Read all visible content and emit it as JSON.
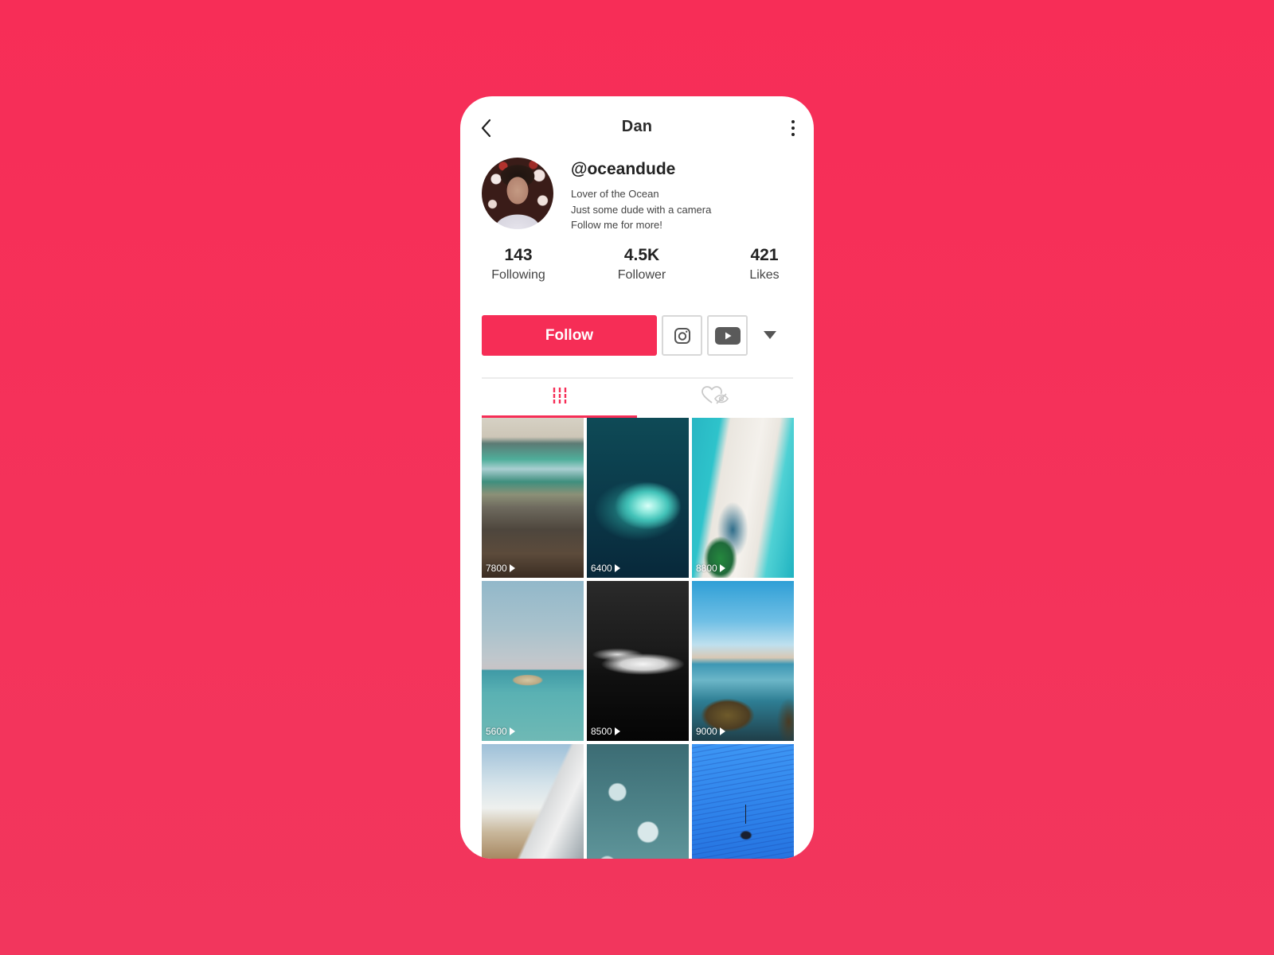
{
  "header": {
    "title": "Dan",
    "back_icon": "chevron-left-icon",
    "more_icon": "vertical-dots-icon"
  },
  "profile": {
    "handle": "@oceandude",
    "bio": [
      "Lover of the Ocean",
      "Just some dude with a camera",
      "Follow me for more!"
    ],
    "avatar": "profile-photo"
  },
  "stats": [
    {
      "value": "143",
      "label": "Following"
    },
    {
      "value": "4.5K",
      "label": "Follower"
    },
    {
      "value": "421",
      "label": "Likes"
    }
  ],
  "actions": {
    "follow_label": "Follow",
    "instagram_icon": "instagram-icon",
    "youtube_icon": "youtube-icon",
    "dropdown_icon": "caret-down-icon"
  },
  "tabs": [
    {
      "name": "videos",
      "icon": "grid-bars-icon",
      "active": true
    },
    {
      "name": "liked",
      "icon": "hidden-heart-icon",
      "active": false
    }
  ],
  "colors": {
    "brand": "#f62d56",
    "background": "#f72d57",
    "text": "#222222",
    "muted": "#444444"
  },
  "videos": [
    {
      "views": "7800",
      "subject": "wave on pebble beach"
    },
    {
      "views": "6400",
      "subject": "aerial reef in deep water"
    },
    {
      "views": "8800",
      "subject": "aerial sandbar with palms"
    },
    {
      "views": "5600",
      "subject": "rock island in calm sea"
    },
    {
      "views": "8500",
      "subject": "black and white surf"
    },
    {
      "views": "9000",
      "subject": "rocky coastline beach"
    },
    {
      "views": "",
      "subject": "misty aerial coastline"
    },
    {
      "views": "",
      "subject": "foamy water over rocks"
    },
    {
      "views": "",
      "subject": "boat on blue water"
    }
  ]
}
